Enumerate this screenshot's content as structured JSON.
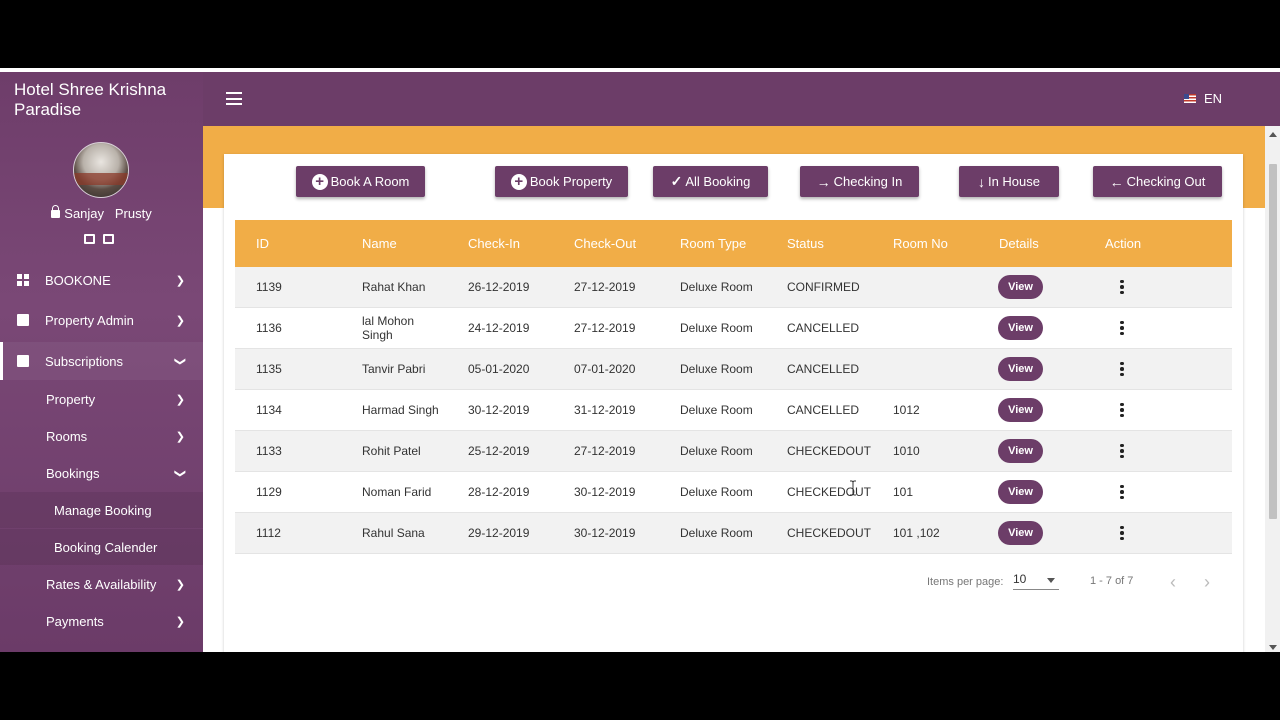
{
  "sidebar": {
    "hotel_name": "Hotel Shree Krishna Paradise",
    "user_name": "Sanjay   Prusty",
    "nav": [
      {
        "label": "BOOKONE",
        "icon": "grid-icon"
      },
      {
        "label": "Property Admin",
        "icon": "book-icon"
      },
      {
        "label": "Subscriptions",
        "icon": "book-icon"
      }
    ],
    "sub": [
      {
        "label": "Property"
      },
      {
        "label": "Rooms"
      },
      {
        "label": "Bookings"
      }
    ],
    "subsub": [
      {
        "label": "Manage Booking"
      },
      {
        "label": "Booking Calender"
      }
    ],
    "more": [
      {
        "label": "Rates & Availability"
      },
      {
        "label": "Payments"
      }
    ]
  },
  "topbar": {
    "lang": "EN"
  },
  "actions": {
    "book_room": "Book A Room",
    "book_property": "Book Property",
    "all_booking": "All Booking",
    "checking_in": "Checking In",
    "in_house": "In House",
    "checking_out": "Checking Out"
  },
  "table": {
    "headers": [
      "ID",
      "Name",
      "Check-In",
      "Check-Out",
      "Room Type",
      "Status",
      "Room No",
      "Details",
      "Action"
    ],
    "view_label": "View",
    "rows": [
      {
        "id": "1139",
        "name": "Rahat Khan",
        "checkin": "26-12-2019",
        "checkout": "27-12-2019",
        "room_type": "Deluxe Room",
        "status": "CONFIRMED",
        "room_no": ""
      },
      {
        "id": "1136",
        "name": "lal Mohon Singh",
        "checkin": "24-12-2019",
        "checkout": "27-12-2019",
        "room_type": "Deluxe Room",
        "status": "CANCELLED",
        "room_no": ""
      },
      {
        "id": "1135",
        "name": "Tanvir Pabri",
        "checkin": "05-01-2020",
        "checkout": "07-01-2020",
        "room_type": "Deluxe Room",
        "status": "CANCELLED",
        "room_no": ""
      },
      {
        "id": "1134",
        "name": "Harmad Singh",
        "checkin": "30-12-2019",
        "checkout": "31-12-2019",
        "room_type": "Deluxe Room",
        "status": "CANCELLED",
        "room_no": "1012"
      },
      {
        "id": "1133",
        "name": "Rohit Patel",
        "checkin": "25-12-2019",
        "checkout": "27-12-2019",
        "room_type": "Deluxe Room",
        "status": "CHECKEDOUT",
        "room_no": "1010"
      },
      {
        "id": "1129",
        "name": "Noman Farid",
        "checkin": "28-12-2019",
        "checkout": "30-12-2019",
        "room_type": "Deluxe Room",
        "status": "CHECKEDOUT",
        "room_no": "101"
      },
      {
        "id": "1112",
        "name": "Rahul Sana",
        "checkin": "29-12-2019",
        "checkout": "30-12-2019",
        "room_type": "Deluxe Room",
        "status": "CHECKEDOUT",
        "room_no": "101 ,102"
      }
    ]
  },
  "paginator": {
    "items_per_page_label": "Items per page:",
    "items_per_page": "10",
    "range": "1 - 7 of 7"
  },
  "colors": {
    "brand": "#6c3d68",
    "accent": "#f1ad47"
  }
}
